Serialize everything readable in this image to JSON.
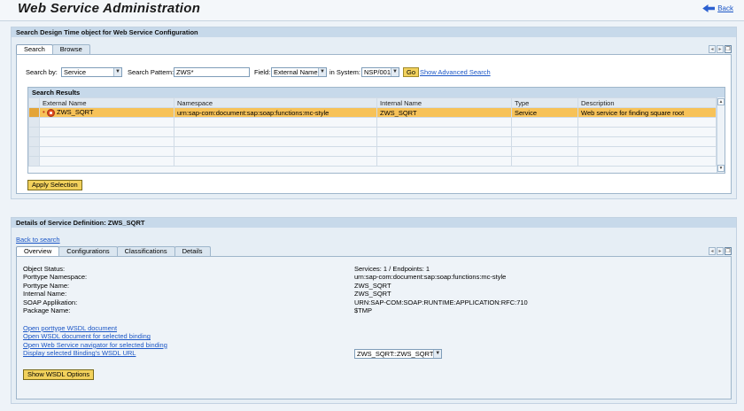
{
  "header": {
    "title": "Web Service Administration",
    "back_label": "Back"
  },
  "search_panel": {
    "title": "Search Design Time object for Web Service Configuration",
    "tabs": [
      "Search",
      "Browse"
    ],
    "search_by_label": "Search by:",
    "search_by_value": "Service",
    "pattern_label": "Search Pattern:",
    "pattern_value": "ZWS*",
    "field_label": "Field:",
    "field_value": "External Name",
    "system_label": "in System:",
    "system_value": "NSP/001",
    "go_label": "Go",
    "advanced_link": "Show Advanced Search",
    "results_title": "Search Results",
    "columns": [
      "External Name",
      "Namespace",
      "Internal Name",
      "Type",
      "Description"
    ],
    "rows": [
      {
        "external_name": "ZWS_SQRT",
        "namespace": "urn:sap-com:document:sap:soap:functions:mc-style",
        "internal_name": "ZWS_SQRT",
        "type": "Service",
        "description": "Web service for finding square root"
      }
    ],
    "apply_label": "Apply Selection"
  },
  "details_panel": {
    "title": "Details of Service Definition: ZWS_SQRT",
    "back_to_search": "Back to search",
    "tabs": [
      "Overview",
      "Configurations",
      "Classifications",
      "Details"
    ],
    "labels": [
      "Object Status:",
      "Porttype Namespace:",
      "Porttype Name:",
      "Internal Name:",
      "SOAP Applikation:",
      "Package Name:"
    ],
    "values": [
      "Services: 1 / Endpoints: 1",
      "urn:sap-com:document:sap:soap:functions:mc-style",
      "ZWS_SQRT",
      "ZWS_SQRT",
      "URN:SAP-COM:SOAP:RUNTIME:APPLICATION:RFC:710",
      "$TMP"
    ],
    "links": [
      "Open porttype WSDL document",
      "Open WSDL document for selected binding",
      "Open Web Service navigator for selected binding",
      "Display selected Binding's WSDL URL"
    ],
    "binding_value": "ZWS_SQRT::ZWS_SQRT",
    "show_wsdl_label": "Show WSDL Options"
  },
  "colors": {
    "selection": "#f7c258",
    "button": "#f2d15c",
    "link": "#1b56c6",
    "panel_header": "#c7d9ea"
  }
}
